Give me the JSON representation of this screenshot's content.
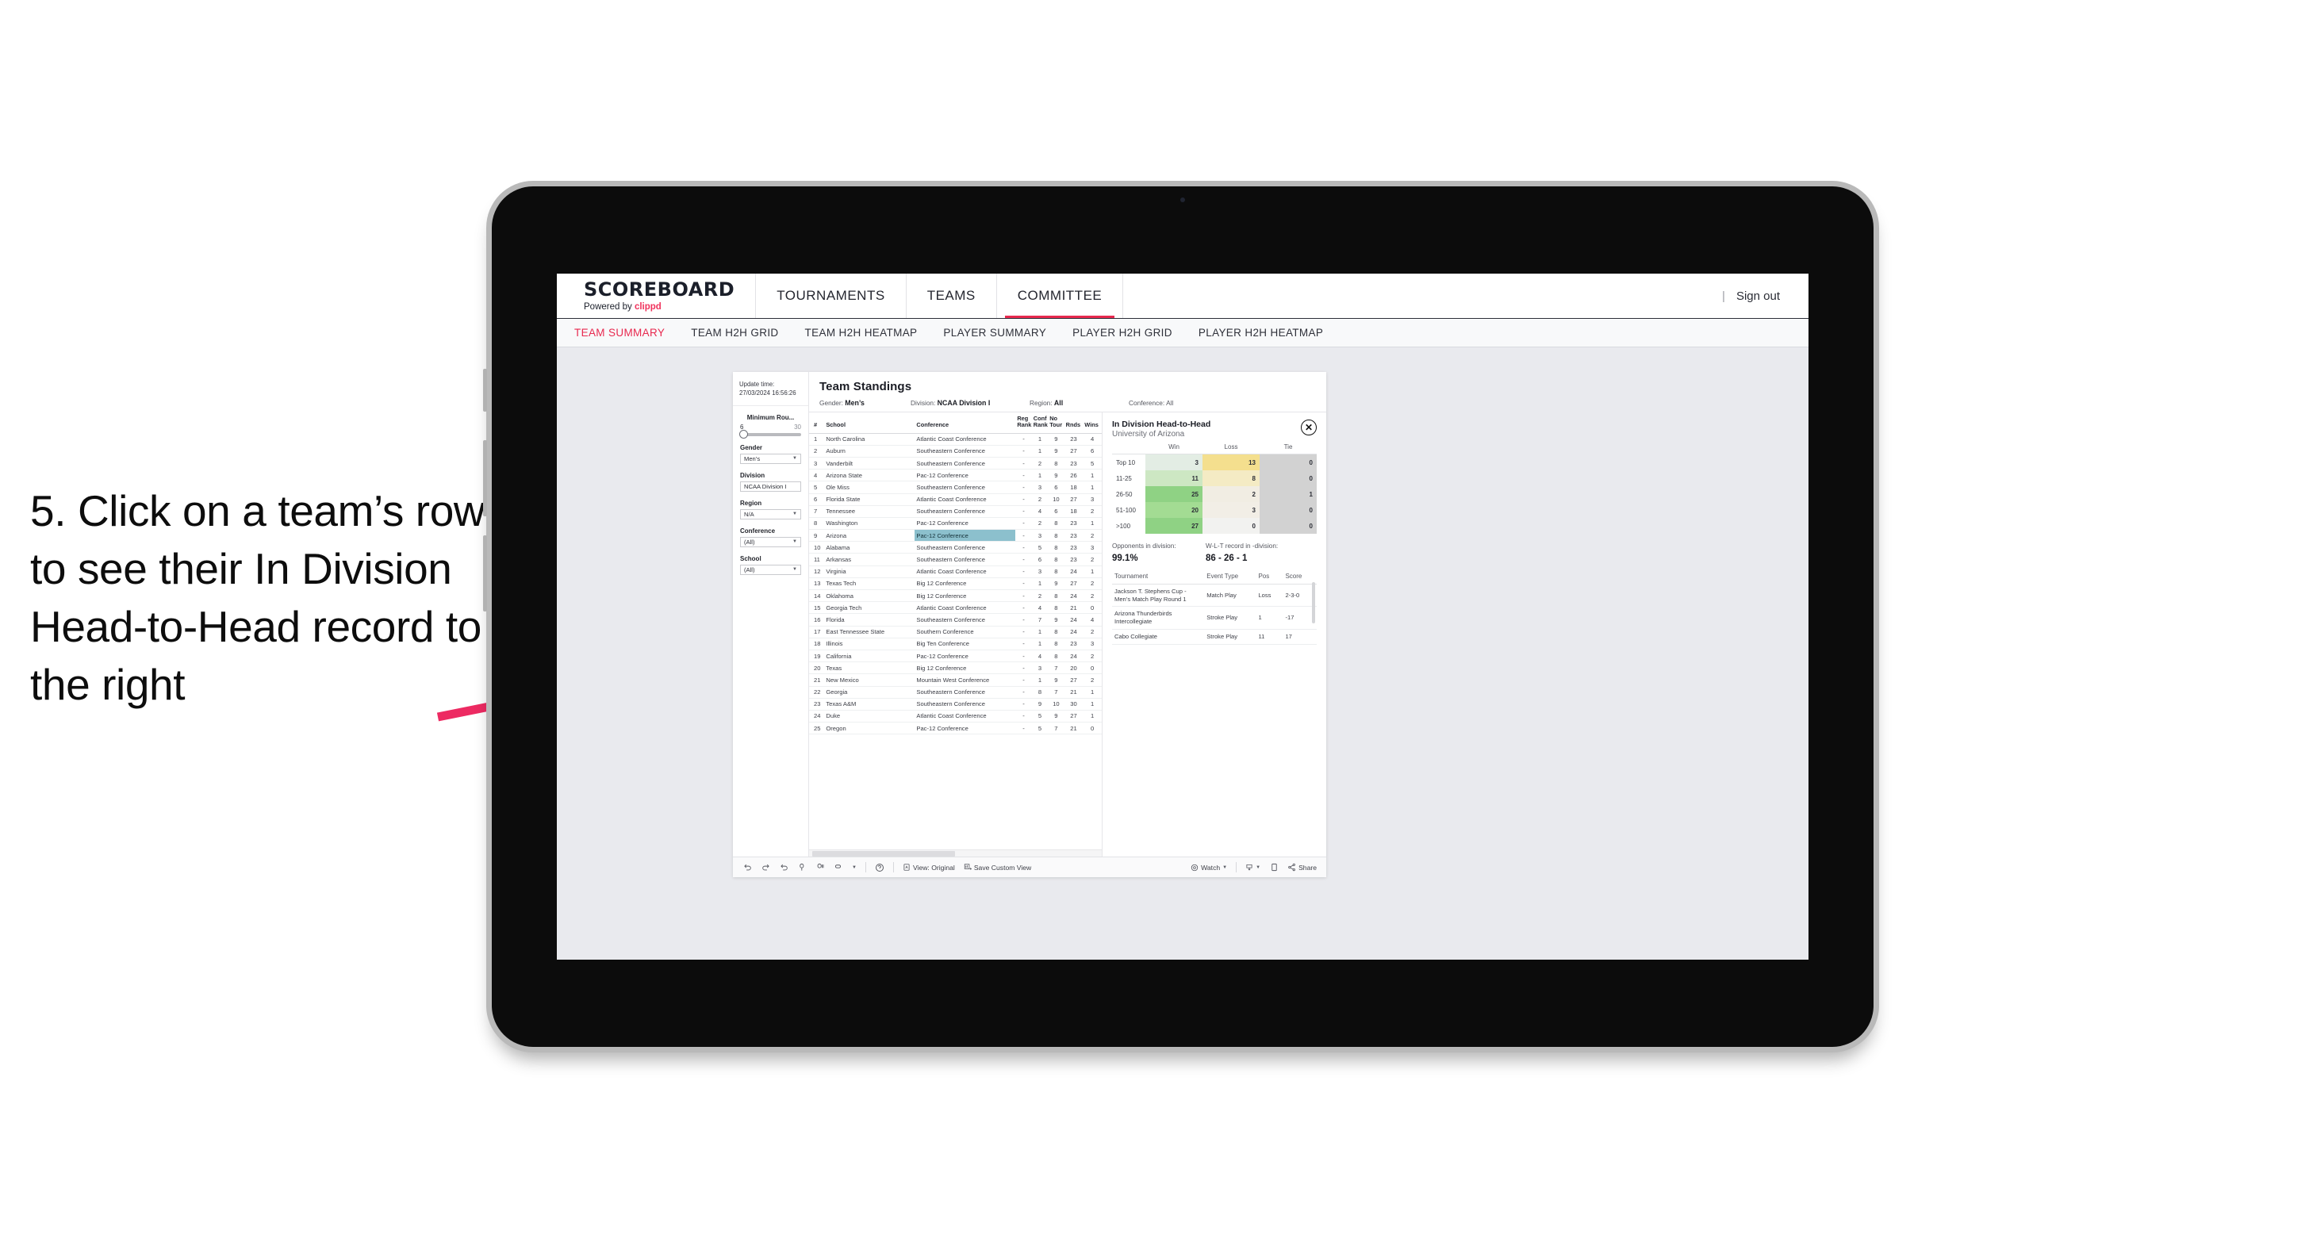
{
  "annotation": {
    "text": "5. Click on a team’s row to see their In Division Head-to-Head record to the right",
    "arrow_color": "#ED2A62"
  },
  "app": {
    "brand_title": "SCOREBOARD",
    "brand_sub_prefix": "Powered by",
    "brand_sub_name": "clippd",
    "accent_color": "#E8294F",
    "top_nav": [
      {
        "label": "TOURNAMENTS",
        "active": false
      },
      {
        "label": "TEAMS",
        "active": false
      },
      {
        "label": "COMMITTEE",
        "active": true
      }
    ],
    "sign_out": "Sign out",
    "sign_out_divider": "|",
    "sub_nav": [
      {
        "label": "TEAM SUMMARY",
        "active": true
      },
      {
        "label": "TEAM H2H GRID",
        "active": false
      },
      {
        "label": "TEAM H2H HEATMAP",
        "active": false
      },
      {
        "label": "PLAYER SUMMARY",
        "active": false
      },
      {
        "label": "PLAYER H2H GRID",
        "active": false
      },
      {
        "label": "PLAYER H2H HEATMAP",
        "active": false
      }
    ]
  },
  "filters": {
    "update_time_label": "Update time:",
    "update_time_value": "27/03/2024 16:56:26",
    "slider": {
      "label": "Minimum Rou...",
      "min": "6",
      "max": "30"
    },
    "selects": [
      {
        "label": "Gender",
        "value": "Men’s"
      },
      {
        "label": "Division",
        "value": "NCAA Division I"
      },
      {
        "label": "Region",
        "value": "N/A"
      },
      {
        "label": "Conference",
        "value": "(All)"
      },
      {
        "label": "School",
        "value": "(All)"
      }
    ]
  },
  "standings": {
    "title": "Team Standings",
    "summary": [
      {
        "label": "Gender:",
        "value": "Men’s"
      },
      {
        "label": "Division:",
        "value": "NCAA Division I"
      },
      {
        "label": "Region:",
        "value": "All"
      },
      {
        "label": "Conference:",
        "value": "All"
      }
    ],
    "columns": [
      "#",
      "School",
      "Conference",
      "Reg Rank",
      "Conf Rank",
      "No Tour",
      "Rnds",
      "Wins"
    ],
    "highlight_color": "#8CC0CD",
    "rows": [
      {
        "n": "1",
        "school": "North Carolina",
        "conf": "Atlantic Coast Conference",
        "reg": "-",
        "cr": "1",
        "nt": "9",
        "rn": "23",
        "wn": "4",
        "hl": false
      },
      {
        "n": "2",
        "school": "Auburn",
        "conf": "Southeastern Conference",
        "reg": "-",
        "cr": "1",
        "nt": "9",
        "rn": "27",
        "wn": "6",
        "hl": false
      },
      {
        "n": "3",
        "school": "Vanderbilt",
        "conf": "Southeastern Conference",
        "reg": "-",
        "cr": "2",
        "nt": "8",
        "rn": "23",
        "wn": "5",
        "hl": false
      },
      {
        "n": "4",
        "school": "Arizona State",
        "conf": "Pac-12 Conference",
        "reg": "-",
        "cr": "1",
        "nt": "9",
        "rn": "26",
        "wn": "1",
        "hl": false
      },
      {
        "n": "5",
        "school": "Ole Miss",
        "conf": "Southeastern Conference",
        "reg": "-",
        "cr": "3",
        "nt": "6",
        "rn": "18",
        "wn": "1",
        "hl": false
      },
      {
        "n": "6",
        "school": "Florida State",
        "conf": "Atlantic Coast Conference",
        "reg": "-",
        "cr": "2",
        "nt": "10",
        "rn": "27",
        "wn": "3",
        "hl": false
      },
      {
        "n": "7",
        "school": "Tennessee",
        "conf": "Southeastern Conference",
        "reg": "-",
        "cr": "4",
        "nt": "6",
        "rn": "18",
        "wn": "2",
        "hl": false
      },
      {
        "n": "8",
        "school": "Washington",
        "conf": "Pac-12 Conference",
        "reg": "-",
        "cr": "2",
        "nt": "8",
        "rn": "23",
        "wn": "1",
        "hl": false
      },
      {
        "n": "9",
        "school": "Arizona",
        "conf": "Pac-12 Conference",
        "reg": "-",
        "cr": "3",
        "nt": "8",
        "rn": "23",
        "wn": "2",
        "hl": true
      },
      {
        "n": "10",
        "school": "Alabama",
        "conf": "Southeastern Conference",
        "reg": "-",
        "cr": "5",
        "nt": "8",
        "rn": "23",
        "wn": "3",
        "hl": false
      },
      {
        "n": "11",
        "school": "Arkansas",
        "conf": "Southeastern Conference",
        "reg": "-",
        "cr": "6",
        "nt": "8",
        "rn": "23",
        "wn": "2",
        "hl": false
      },
      {
        "n": "12",
        "school": "Virginia",
        "conf": "Atlantic Coast Conference",
        "reg": "-",
        "cr": "3",
        "nt": "8",
        "rn": "24",
        "wn": "1",
        "hl": false
      },
      {
        "n": "13",
        "school": "Texas Tech",
        "conf": "Big 12 Conference",
        "reg": "-",
        "cr": "1",
        "nt": "9",
        "rn": "27",
        "wn": "2",
        "hl": false
      },
      {
        "n": "14",
        "school": "Oklahoma",
        "conf": "Big 12 Conference",
        "reg": "-",
        "cr": "2",
        "nt": "8",
        "rn": "24",
        "wn": "2",
        "hl": false
      },
      {
        "n": "15",
        "school": "Georgia Tech",
        "conf": "Atlantic Coast Conference",
        "reg": "-",
        "cr": "4",
        "nt": "8",
        "rn": "21",
        "wn": "0",
        "hl": false
      },
      {
        "n": "16",
        "school": "Florida",
        "conf": "Southeastern Conference",
        "reg": "-",
        "cr": "7",
        "nt": "9",
        "rn": "24",
        "wn": "4",
        "hl": false
      },
      {
        "n": "17",
        "school": "East Tennessee State",
        "conf": "Southern Conference",
        "reg": "-",
        "cr": "1",
        "nt": "8",
        "rn": "24",
        "wn": "2",
        "hl": false
      },
      {
        "n": "18",
        "school": "Illinois",
        "conf": "Big Ten Conference",
        "reg": "-",
        "cr": "1",
        "nt": "8",
        "rn": "23",
        "wn": "3",
        "hl": false
      },
      {
        "n": "19",
        "school": "California",
        "conf": "Pac-12 Conference",
        "reg": "-",
        "cr": "4",
        "nt": "8",
        "rn": "24",
        "wn": "2",
        "hl": false
      },
      {
        "n": "20",
        "school": "Texas",
        "conf": "Big 12 Conference",
        "reg": "-",
        "cr": "3",
        "nt": "7",
        "rn": "20",
        "wn": "0",
        "hl": false
      },
      {
        "n": "21",
        "school": "New Mexico",
        "conf": "Mountain West Conference",
        "reg": "-",
        "cr": "1",
        "nt": "9",
        "rn": "27",
        "wn": "2",
        "hl": false
      },
      {
        "n": "22",
        "school": "Georgia",
        "conf": "Southeastern Conference",
        "reg": "-",
        "cr": "8",
        "nt": "7",
        "rn": "21",
        "wn": "1",
        "hl": false
      },
      {
        "n": "23",
        "school": "Texas A&M",
        "conf": "Southeastern Conference",
        "reg": "-",
        "cr": "9",
        "nt": "10",
        "rn": "30",
        "wn": "1",
        "hl": false
      },
      {
        "n": "24",
        "school": "Duke",
        "conf": "Atlantic Coast Conference",
        "reg": "-",
        "cr": "5",
        "nt": "9",
        "rn": "27",
        "wn": "1",
        "hl": false
      },
      {
        "n": "25",
        "school": "Oregon",
        "conf": "Pac-12 Conference",
        "reg": "-",
        "cr": "5",
        "nt": "7",
        "rn": "21",
        "wn": "0",
        "hl": false
      }
    ]
  },
  "h2h": {
    "title": "In Division Head-to-Head",
    "subtitle": "University of Arizona",
    "close_icon": "✕",
    "chart_data": {
      "type": "heatmap",
      "title": "In Division Head-to-Head",
      "subtitle": "University of Arizona",
      "columns": [
        "Win",
        "Loss",
        "Tie"
      ],
      "categories": [
        "Top 10",
        "11-25",
        "26-50",
        "51-100",
        ">100"
      ],
      "series": [
        {
          "name": "Win",
          "values": [
            3,
            11,
            25,
            20,
            27
          ]
        },
        {
          "name": "Loss",
          "values": [
            13,
            8,
            2,
            3,
            0
          ]
        },
        {
          "name": "Tie",
          "values": [
            0,
            0,
            1,
            0,
            0
          ]
        }
      ],
      "cell_colors": {
        "win": [
          "#E3EDE4",
          "#CDE7C3",
          "#8FD284",
          "#A3DC93",
          "#8FD284"
        ],
        "loss": [
          "#F4DF8E",
          "#F4EBC4",
          "#F1EDE3",
          "#F2EEE6",
          "#F2F2F0"
        ],
        "tie": [
          "#D2D2D2",
          "#D2D2D2",
          "#D2D2D2",
          "#D2D2D2",
          "#D2D2D2"
        ]
      }
    },
    "stats": [
      {
        "label": "Opponents in division:",
        "value": "99.1%"
      },
      {
        "label": "W-L-T record in -division:",
        "value": "86 - 26 - 1"
      }
    ],
    "tournament_columns": [
      "Tournament",
      "Event Type",
      "Pos",
      "Score"
    ],
    "tournaments": [
      {
        "name": "Jackson T. Stephens Cup - Men’s Match Play Round 1",
        "type": "Match Play",
        "pos": "Loss",
        "score": "2-3-0"
      },
      {
        "name": "Arizona Thunderbirds Intercollegiate",
        "type": "Stroke Play",
        "pos": "1",
        "score": "-17"
      },
      {
        "name": "Cabo Collegiate",
        "type": "Stroke Play",
        "pos": "11",
        "score": "17"
      }
    ]
  },
  "toolbar": {
    "icons": [
      "undo-icon",
      "redo-icon",
      "revert-icon",
      "refresh-icon",
      "pause-icon",
      "alerts-icon",
      "help-icon"
    ],
    "view_label": "View: Original",
    "save_label": "Save Custom View",
    "watch_label": "Watch",
    "share_label": "Share"
  }
}
